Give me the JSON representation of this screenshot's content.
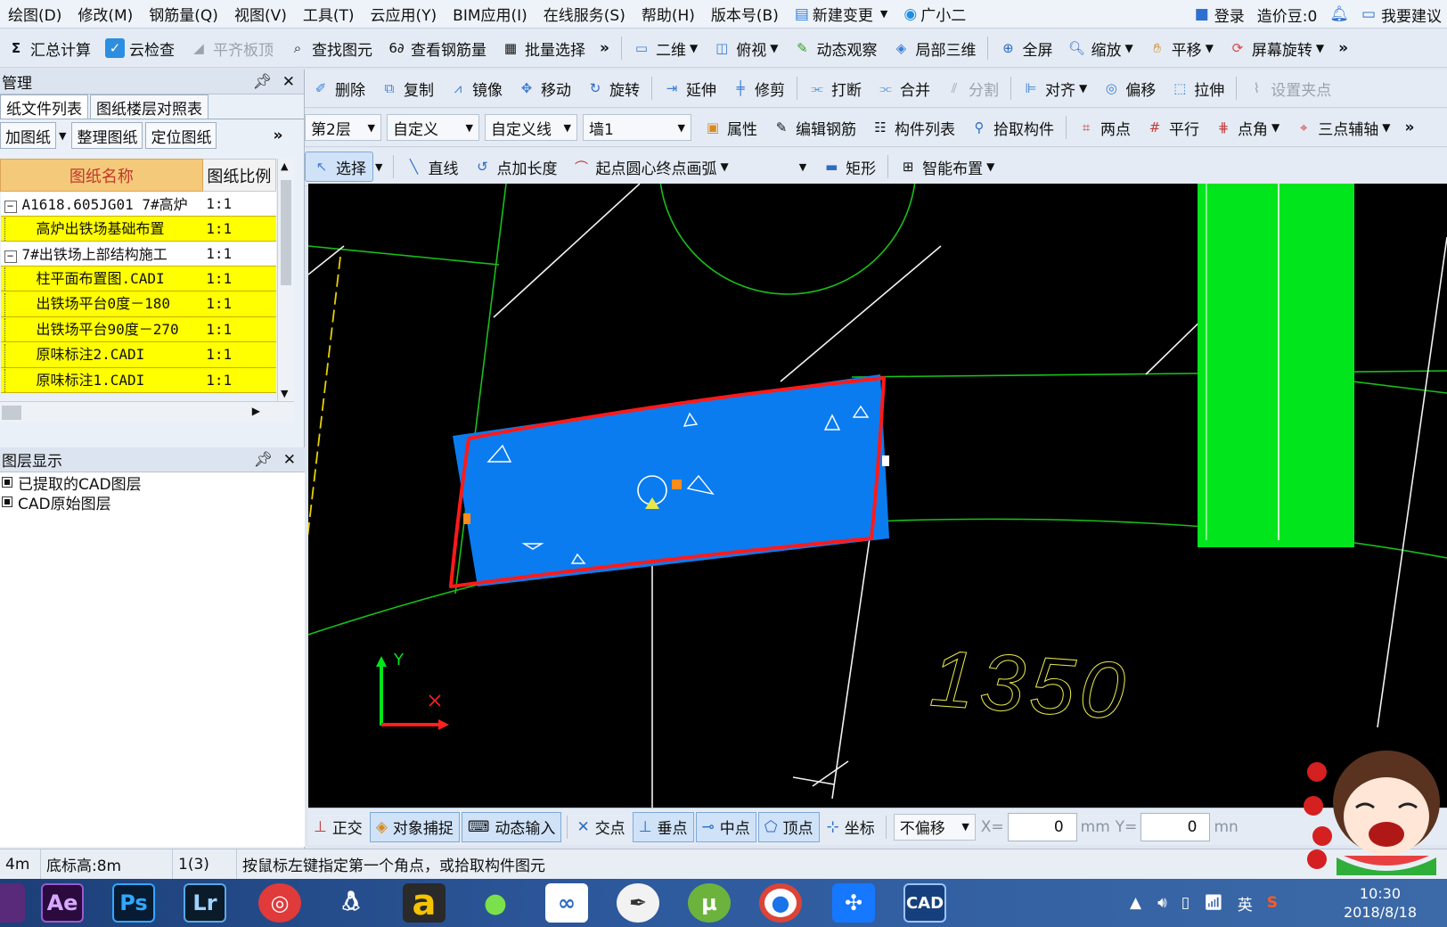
{
  "menubar": {
    "items": [
      "绘图(D)",
      "修改(M)",
      "钢筋量(Q)",
      "视图(V)",
      "工具(T)",
      "云应用(Y)",
      "BIM应用(I)",
      "在线服务(S)",
      "帮助(H)",
      "版本号(B)",
      "新建变更",
      "广小二"
    ],
    "login": "登录",
    "beans": "造价豆:0",
    "suggest": "我要建议"
  },
  "toolbar1": {
    "summary": "汇总计算",
    "cloud_check": "云检查",
    "flush_top": "平齐板顶",
    "find_element": "查找图元",
    "view_rebar": "查看钢筋量",
    "batch_select": "批量选择",
    "view_2d": "二维",
    "top_view": "俯视",
    "dynamic_view": "动态观察",
    "local_3d": "局部三维",
    "fullscreen": "全屏",
    "zoom": "缩放",
    "pan": "平移",
    "rotate_screen": "屏幕旋转"
  },
  "toolbar2": {
    "delete": "删除",
    "copy": "复制",
    "mirror": "镜像",
    "move": "移动",
    "rotate": "旋转",
    "extend": "延伸",
    "trim": "修剪",
    "break": "打断",
    "merge": "合并",
    "split": "分割",
    "align": "对齐",
    "offset": "偏移",
    "stretch": "拉伸",
    "set_grip": "设置夹点"
  },
  "toolbar3": {
    "floor": "第2层",
    "custom": "自定义",
    "custom_line": "自定义线",
    "wall": "墙1",
    "property": "属性",
    "edit_rebar": "编辑钢筋",
    "component_list": "构件列表",
    "pick_component": "拾取构件",
    "two_points": "两点",
    "parallel": "平行",
    "point_angle": "点角",
    "three_point_axis": "三点辅轴"
  },
  "toolbar4": {
    "select": "选择",
    "line": "直线",
    "point_length": "点加长度",
    "arc": "起点圆心终点画弧",
    "rectangle": "矩形",
    "smart_layout": "智能布置"
  },
  "left_panel": {
    "title": "管理",
    "tabs": [
      "纸文件列表",
      "图纸楼层对照表"
    ],
    "buttons": [
      "加图纸",
      "整理图纸",
      "定位图纸"
    ],
    "columns": [
      "图纸名称",
      "图纸比例"
    ],
    "rows": [
      {
        "name": "A1618.605JG01 7#高炉",
        "scale": "1:1",
        "tree": "−",
        "level": 0,
        "color": "white"
      },
      {
        "name": "高炉出铁场基础布置",
        "scale": "1:1",
        "tree": "",
        "level": 1,
        "color": "yellow"
      },
      {
        "name": "7#出铁场上部结构施工",
        "scale": "1:1",
        "tree": "−",
        "level": 0,
        "color": "white"
      },
      {
        "name": "柱平面布置图.CADI",
        "scale": "1:1",
        "tree": "",
        "level": 1,
        "color": "yellow"
      },
      {
        "name": "出铁场平台0度－180",
        "scale": "1:1",
        "tree": "",
        "level": 1,
        "color": "yellow"
      },
      {
        "name": "出铁场平台90度－270",
        "scale": "1:1",
        "tree": "",
        "level": 1,
        "color": "yellow"
      },
      {
        "name": "原味标注2.CADI",
        "scale": "1:1",
        "tree": "",
        "level": 1,
        "color": "yellow"
      },
      {
        "name": "原味标注1.CADI",
        "scale": "1:1",
        "tree": "",
        "level": 1,
        "color": "yellow"
      }
    ],
    "layer_title": "图层显示",
    "layers": [
      "已提取的CAD图层",
      "CAD原始图层"
    ]
  },
  "canvas": {
    "dimension_text": "1350",
    "axis_y": "Y",
    "axis_x": "X"
  },
  "snapbar": {
    "ortho": "正交",
    "osnap": "对象捕捉",
    "dyn_input": "动态输入",
    "intersection": "交点",
    "perpendicular": "垂点",
    "midpoint": "中点",
    "vertex": "顶点",
    "coordinate": "坐标",
    "offset_mode": "不偏移",
    "x_label": "X=",
    "x_value": "0",
    "x_unit": "mm",
    "y_label": "Y=",
    "y_value": "0",
    "y_unit": "mn"
  },
  "statusbar": {
    "left": "4m",
    "base_elev": "底标高:8m",
    "count": "1(3)",
    "hint": "按鼠标左键指定第一个角点，或拾取构件图元"
  },
  "taskbar": {
    "apps": [
      "Ae",
      "Ps",
      "Lr",
      "a",
      "CAD"
    ],
    "lang": "英",
    "time": "10:30",
    "date": "2018/8/18"
  },
  "colors": {
    "canvas_bg": "#000000",
    "slab_fill": "#0a7cf0",
    "outline_red": "#ff1a1a",
    "column_green": "#00e51c",
    "cad_green": "#18c018",
    "dim_yellow": "#e8e84a",
    "highlight_yellow": "#ffff00"
  }
}
